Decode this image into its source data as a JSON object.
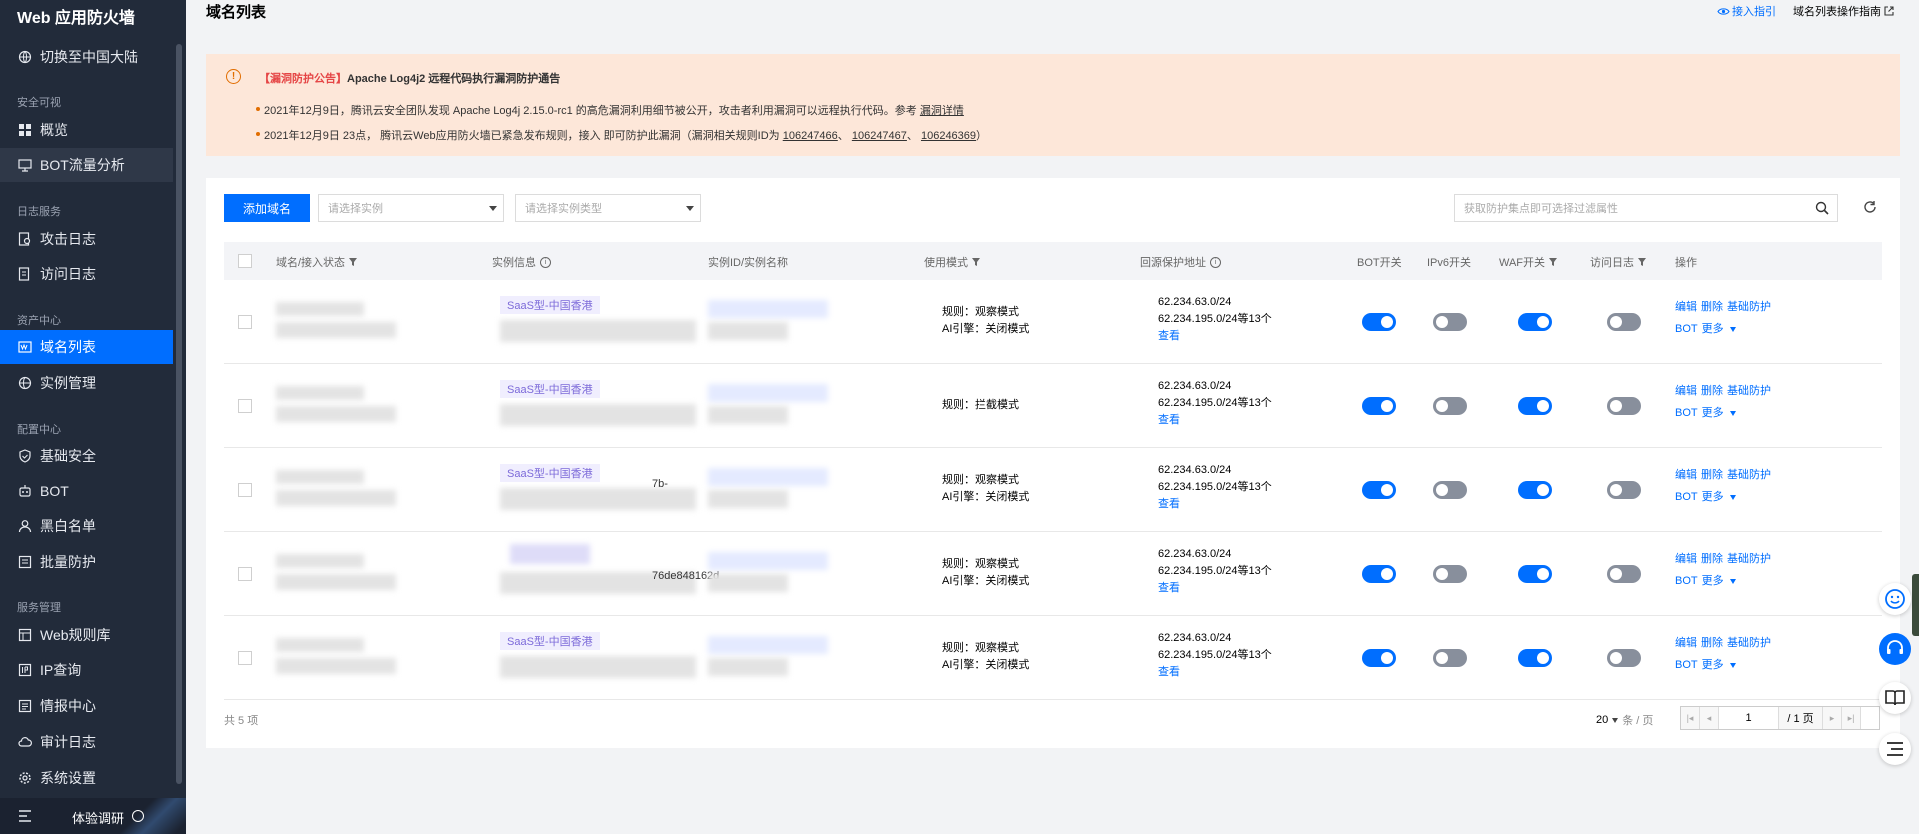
{
  "app": {
    "title": "Web 应用防火墙"
  },
  "sidebar": {
    "switch_region": "切换至中国大陆",
    "groups": [
      {
        "label": "安全可视",
        "items": [
          {
            "label": "概览"
          },
          {
            "label": "BOT流量分析"
          }
        ]
      },
      {
        "label": "日志服务",
        "items": [
          {
            "label": "攻击日志"
          },
          {
            "label": "访问日志"
          }
        ]
      },
      {
        "label": "资产中心",
        "items": [
          {
            "label": "域名列表"
          },
          {
            "label": "实例管理"
          }
        ]
      },
      {
        "label": "配置中心",
        "items": [
          {
            "label": "基础安全"
          },
          {
            "label": "BOT"
          },
          {
            "label": "黑白名单"
          },
          {
            "label": "批量防护"
          }
        ]
      },
      {
        "label": "服务管理",
        "items": [
          {
            "label": "Web规则库"
          },
          {
            "label": "IP查询"
          },
          {
            "label": "情报中心"
          },
          {
            "label": "审计日志"
          },
          {
            "label": "系统设置"
          }
        ]
      }
    ],
    "footer": {
      "trial": "体验调研"
    }
  },
  "header": {
    "title": "域名列表",
    "link_access": "接入指引",
    "link_guide": "域名列表操作指南"
  },
  "notice": {
    "title_tag": "【漏洞防护公告】",
    "title_text": "Apache Log4j2 远程代码执行漏洞防护通告",
    "line1_text": "2021年12月9日，腾讯云安全团队发现 Apache Log4j 2.15.0-rc1 的高危漏洞利用细节被公开，攻击者利用漏洞可以远程执行代码。参考",
    "line1_link": "漏洞详情",
    "line2_text": "2021年12月9日 23点， 腾讯云Web应用防火墙已紧急发布规则，接入 即可防护此漏洞（漏洞相关规则ID为",
    "line2_ids": [
      "106247466",
      "106247467",
      "106246369"
    ],
    "line2_end": "）"
  },
  "toolbar": {
    "add_label": "添加域名",
    "select_instance_placeholder": "请选择实例",
    "select_type_placeholder": "请选择实例类型",
    "search_placeholder": "获取防护集点即可选择过滤属性"
  },
  "table": {
    "headers": {
      "domain": "域名/接入状态",
      "instance": "实例信息",
      "instance_id": "实例ID/实例名称",
      "mode": "使用模式",
      "origin": "回源保护地址",
      "bot": "BOT开关",
      "ipv6": "IPv6开关",
      "waf": "WAF开关",
      "access_log": "访问日志",
      "ops": "操作"
    },
    "rows": [
      {
        "tag": "SaaS型-中国香港",
        "frag": "",
        "mode_rule": "规则：观察模式",
        "mode_ai": "AI引擎：关闭模式",
        "addr1": "62.234.63.0/24",
        "addr2": "62.234.195.0/24等13个",
        "view": "查看",
        "bot": true,
        "ipv6": false,
        "waf": true,
        "log": false
      },
      {
        "tag": "SaaS型-中国香港",
        "frag": "",
        "mode_rule": "规则：拦截模式",
        "mode_ai": "",
        "addr1": "62.234.63.0/24",
        "addr2": "62.234.195.0/24等13个",
        "view": "查看",
        "bot": true,
        "ipv6": false,
        "waf": true,
        "log": false
      },
      {
        "tag": "SaaS型-中国香港",
        "frag": "7b-",
        "mode_rule": "规则：观察模式",
        "mode_ai": "AI引擎：关闭模式",
        "addr1": "62.234.63.0/24",
        "addr2": "62.234.195.0/24等13个",
        "view": "查看",
        "bot": true,
        "ipv6": false,
        "waf": true,
        "log": false
      },
      {
        "tag": "",
        "frag": "76de848162d",
        "mode_rule": "规则：观察模式",
        "mode_ai": "AI引擎：关闭模式",
        "addr1": "62.234.63.0/24",
        "addr2": "62.234.195.0/24等13个",
        "view": "查看",
        "bot": true,
        "ipv6": false,
        "waf": true,
        "log": false
      },
      {
        "tag": "SaaS型-中国香港",
        "frag": "",
        "mode_rule": "规则：观察模式",
        "mode_ai": "AI引擎：关闭模式",
        "addr1": "62.234.63.0/24",
        "addr2": "62.234.195.0/24等13个",
        "view": "查看",
        "bot": true,
        "ipv6": false,
        "waf": true,
        "log": false
      }
    ],
    "ops": {
      "edit": "编辑",
      "delete": "删除",
      "basic": "基础防护",
      "bot": "BOT",
      "more": "更多"
    }
  },
  "pagination": {
    "total": "共 5 项",
    "page_size": "20",
    "page_size_unit": "条 / 页",
    "current_page": "1",
    "total_pages": "/ 1 页"
  },
  "colors": {
    "primary": "#006eff",
    "sidebar_bg": "#222b3a",
    "notice_bg": "#fde7d9",
    "warn": "#e16d00"
  }
}
